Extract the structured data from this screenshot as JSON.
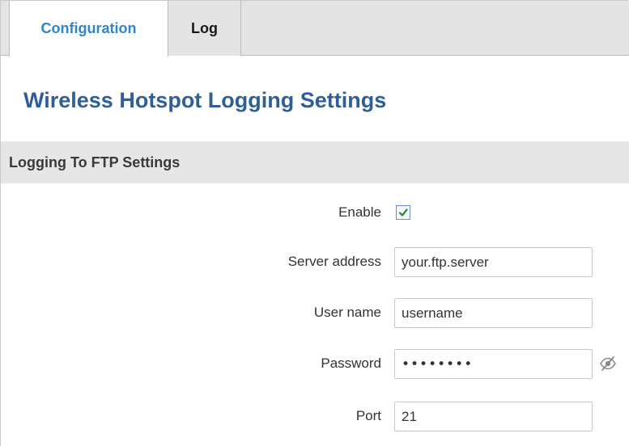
{
  "tabs": {
    "configuration": "Configuration",
    "log": "Log"
  },
  "page": {
    "title": "Wireless Hotspot Logging Settings"
  },
  "section": {
    "title": "Logging To FTP Settings"
  },
  "form": {
    "enable": {
      "label": "Enable",
      "checked": true
    },
    "server_address": {
      "label": "Server address",
      "value": "your.ftp.server"
    },
    "user_name": {
      "label": "User name",
      "value": "username"
    },
    "password": {
      "label": "Password",
      "value": "••••••••",
      "toggle_icon": "eye-slash-icon"
    },
    "port": {
      "label": "Port",
      "value": "21"
    }
  },
  "colors": {
    "active_tab_text": "#2f86c8",
    "title": "#2f5f95",
    "tab_bar": "#e4e4e4",
    "section_bar": "#e6e6e6"
  }
}
